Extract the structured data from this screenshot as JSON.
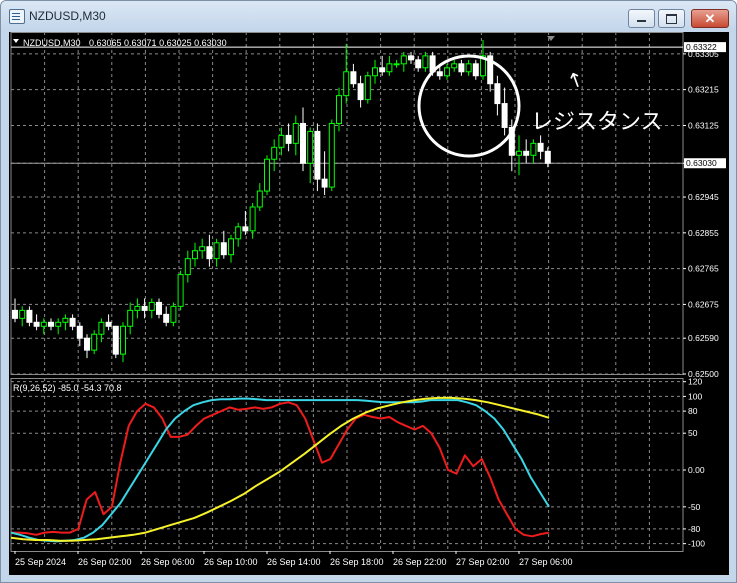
{
  "window": {
    "title": "NZDUSD,M30",
    "minimize_symbol": "‒",
    "maximize_symbol": "□",
    "close_symbol": "✕"
  },
  "chart_header": {
    "symbol": "NZDUSD,M30",
    "ohlc": "0.63065 0.63071 0.63025 0.63030"
  },
  "indicator_header": "R(9,26,52) -85.0 -54.3 70.8",
  "annotation": {
    "text": "レジスタンス",
    "arrow_symbol": "↑"
  },
  "colors": {
    "background": "#000000",
    "grid": "#8a8a8a",
    "bull": "#00ff00",
    "bear": "#ffffff",
    "line_red": "#ee1c1c",
    "line_cyan": "#3ad6e6",
    "line_yellow": "#f6f22a"
  },
  "chart_data": [
    {
      "type": "candlestick",
      "title": "NZDUSD,M30",
      "y_ticks": [
        "0.63305",
        "0.63215",
        "0.63125",
        "0.63030",
        "0.62945",
        "0.62855",
        "0.62765",
        "0.62675",
        "0.62590",
        "0.62500"
      ],
      "ylim": [
        0.625,
        0.6336
      ],
      "price_labels": {
        "resistance": "0.63322",
        "current": "0.63030"
      },
      "horizontal_lines": [
        {
          "name": "resistance",
          "value": 0.63322,
          "color": "#ffffff"
        },
        {
          "name": "current",
          "value": 0.6303,
          "color": "#a0a0a0"
        }
      ],
      "x_ticks": [
        "25 Sep 2024",
        "26 Sep 02:00",
        "26 Sep 06:00",
        "26 Sep 10:00",
        "26 Sep 14:00",
        "26 Sep 18:00",
        "26 Sep 22:00",
        "27 Sep 02:00",
        "27 Sep 06:00"
      ],
      "candles": [
        [
          0.6266,
          0.6269,
          0.6263,
          0.6264
        ],
        [
          0.6264,
          0.6267,
          0.6262,
          0.6266
        ],
        [
          0.6266,
          0.6267,
          0.6262,
          0.6263
        ],
        [
          0.6263,
          0.6265,
          0.6261,
          0.6262
        ],
        [
          0.6262,
          0.6264,
          0.626,
          0.6263
        ],
        [
          0.6263,
          0.6264,
          0.6261,
          0.6262
        ],
        [
          0.6262,
          0.6264,
          0.626,
          0.6263
        ],
        [
          0.6263,
          0.6265,
          0.6261,
          0.6264
        ],
        [
          0.6264,
          0.6265,
          0.6261,
          0.6262
        ],
        [
          0.6262,
          0.6263,
          0.6257,
          0.6259
        ],
        [
          0.6259,
          0.626,
          0.6254,
          0.6256
        ],
        [
          0.6256,
          0.6261,
          0.6255,
          0.626
        ],
        [
          0.626,
          0.6264,
          0.6258,
          0.6263
        ],
        [
          0.6263,
          0.6265,
          0.6261,
          0.6262
        ],
        [
          0.6262,
          0.6262,
          0.6254,
          0.6255
        ],
        [
          0.6255,
          0.6263,
          0.6253,
          0.6262
        ],
        [
          0.6262,
          0.6268,
          0.626,
          0.6266
        ],
        [
          0.6266,
          0.6269,
          0.6264,
          0.6267
        ],
        [
          0.6267,
          0.6269,
          0.6264,
          0.6266
        ],
        [
          0.6266,
          0.6269,
          0.6264,
          0.6268
        ],
        [
          0.6268,
          0.6269,
          0.6264,
          0.6265
        ],
        [
          0.6265,
          0.6267,
          0.6262,
          0.6263
        ],
        [
          0.6263,
          0.6268,
          0.6262,
          0.6267
        ],
        [
          0.6267,
          0.6276,
          0.6266,
          0.6275
        ],
        [
          0.6275,
          0.6281,
          0.6273,
          0.6279
        ],
        [
          0.6279,
          0.6283,
          0.6277,
          0.6281
        ],
        [
          0.6281,
          0.6284,
          0.6279,
          0.6282
        ],
        [
          0.6282,
          0.6285,
          0.6277,
          0.6279
        ],
        [
          0.6279,
          0.6284,
          0.6277,
          0.6283
        ],
        [
          0.6283,
          0.6286,
          0.6279,
          0.628
        ],
        [
          0.628,
          0.6285,
          0.6278,
          0.6284
        ],
        [
          0.6284,
          0.6288,
          0.6282,
          0.6287
        ],
        [
          0.6287,
          0.6291,
          0.6285,
          0.6286
        ],
        [
          0.6286,
          0.6293,
          0.6284,
          0.6292
        ],
        [
          0.6292,
          0.6298,
          0.6291,
          0.6296
        ],
        [
          0.6296,
          0.6305,
          0.6295,
          0.6304
        ],
        [
          0.6304,
          0.6309,
          0.6301,
          0.6307
        ],
        [
          0.6307,
          0.6312,
          0.6305,
          0.631
        ],
        [
          0.631,
          0.6313,
          0.6306,
          0.6308
        ],
        [
          0.6308,
          0.6315,
          0.6305,
          0.6313
        ],
        [
          0.6313,
          0.6317,
          0.6301,
          0.6303
        ],
        [
          0.6303,
          0.6312,
          0.6298,
          0.6311
        ],
        [
          0.6311,
          0.6313,
          0.6296,
          0.6299
        ],
        [
          0.6299,
          0.6306,
          0.6295,
          0.6297
        ],
        [
          0.6297,
          0.6314,
          0.6296,
          0.6313
        ],
        [
          0.6313,
          0.6322,
          0.6311,
          0.632
        ],
        [
          0.632,
          0.6333,
          0.6318,
          0.6326
        ],
        [
          0.6326,
          0.6328,
          0.6322,
          0.6323
        ],
        [
          0.6323,
          0.6325,
          0.6317,
          0.6319
        ],
        [
          0.6319,
          0.6326,
          0.6318,
          0.6325
        ],
        [
          0.6325,
          0.6329,
          0.6323,
          0.6327
        ],
        [
          0.6327,
          0.633,
          0.6325,
          0.6326
        ],
        [
          0.6326,
          0.633,
          0.6325,
          0.6328
        ],
        [
          0.6328,
          0.6329,
          0.6327,
          0.6328
        ],
        [
          0.6328,
          0.6331,
          0.6326,
          0.633
        ],
        [
          0.633,
          0.6331,
          0.6328,
          0.6329
        ],
        [
          0.6329,
          0.633,
          0.6326,
          0.6327
        ],
        [
          0.6327,
          0.6331,
          0.6326,
          0.633
        ],
        [
          0.633,
          0.6331,
          0.6325,
          0.6326
        ],
        [
          0.6326,
          0.6328,
          0.6324,
          0.6325
        ],
        [
          0.6325,
          0.6328,
          0.6324,
          0.6327
        ],
        [
          0.6327,
          0.6329,
          0.6326,
          0.6328
        ],
        [
          0.6328,
          0.6329,
          0.6325,
          0.6326
        ],
        [
          0.6326,
          0.6329,
          0.6325,
          0.6328
        ],
        [
          0.6328,
          0.6329,
          0.6324,
          0.6325
        ],
        [
          0.6325,
          0.6334,
          0.6324,
          0.633
        ],
        [
          0.633,
          0.6331,
          0.6321,
          0.6323
        ],
        [
          0.6323,
          0.6325,
          0.6315,
          0.6318
        ],
        [
          0.6318,
          0.6322,
          0.631,
          0.6312
        ],
        [
          0.6312,
          0.6314,
          0.6301,
          0.6305
        ],
        [
          0.6305,
          0.631,
          0.63,
          0.6306
        ],
        [
          0.6306,
          0.6309,
          0.6303,
          0.6305
        ],
        [
          0.6305,
          0.6309,
          0.6303,
          0.6308
        ],
        [
          0.6308,
          0.631,
          0.6304,
          0.6306
        ],
        [
          0.6306,
          0.6307,
          0.6302,
          0.6303
        ]
      ]
    },
    {
      "type": "line",
      "title": "R(9,26,52)",
      "y_ticks": [
        "120",
        "100",
        "80",
        "50",
        "0.00",
        "-50",
        "-80",
        "-100"
      ],
      "ylim": [
        -110,
        125
      ],
      "series": [
        {
          "name": "9",
          "color": "#ee1c1c",
          "values": [
            -85,
            -85,
            -86,
            -88,
            -85,
            -84,
            -85,
            -85,
            -80,
            -40,
            -30,
            -60,
            -50,
            10,
            60,
            80,
            90,
            85,
            70,
            45,
            45,
            48,
            60,
            70,
            75,
            80,
            85,
            82,
            83,
            85,
            83,
            85,
            90,
            92,
            88,
            70,
            40,
            10,
            15,
            35,
            55,
            70,
            75,
            72,
            70,
            72,
            65,
            60,
            55,
            60,
            50,
            30,
            0,
            -5,
            20,
            5,
            15,
            -10,
            -40,
            -60,
            -80,
            -88,
            -90,
            -87,
            -85
          ]
        },
        {
          "name": "26",
          "color": "#3ad6e6",
          "values": [
            -85,
            -88,
            -92,
            -95,
            -96,
            -97,
            -96,
            -95,
            -92,
            -85,
            -75,
            -60,
            -45,
            -25,
            -5,
            15,
            35,
            55,
            70,
            80,
            88,
            92,
            95,
            96,
            96,
            97,
            97,
            96,
            95,
            95,
            95,
            95,
            95,
            95,
            95,
            95,
            95,
            95,
            95,
            94,
            93,
            92,
            92,
            92,
            92,
            93,
            95,
            95,
            95,
            95,
            92,
            88,
            80,
            70,
            55,
            35,
            15,
            -10,
            -30,
            -50
          ]
        },
        {
          "name": "52",
          "color": "#f6f22a",
          "values": [
            -92,
            -94,
            -95,
            -95,
            -96,
            -96,
            -95,
            -94,
            -92,
            -90,
            -88,
            -85,
            -80,
            -75,
            -70,
            -65,
            -58,
            -50,
            -42,
            -33,
            -22,
            -12,
            -2,
            10,
            22,
            35,
            48,
            60,
            70,
            78,
            84,
            88,
            92,
            95,
            97,
            98,
            98,
            97,
            95,
            92,
            88,
            84,
            80,
            76,
            71
          ]
        }
      ]
    }
  ]
}
